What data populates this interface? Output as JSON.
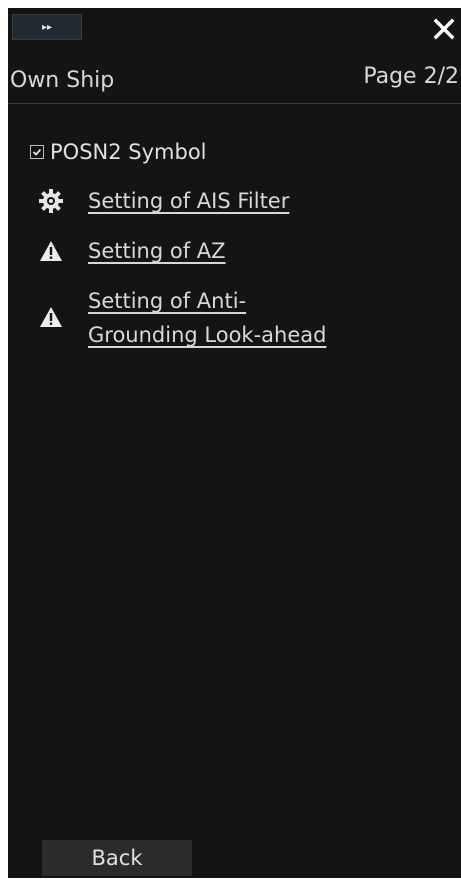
{
  "topbar": {
    "expand_glyph": "▸▸",
    "close_icon": "close-icon"
  },
  "header": {
    "title": "Own Ship",
    "page": "Page 2/2"
  },
  "items": {
    "posn2": {
      "label": "POSN2 Symbol",
      "checked": true
    },
    "ais_filter": {
      "label": "Setting of AIS Filter",
      "icon": "gear-icon"
    },
    "az": {
      "label": "Setting of AZ",
      "icon": "warning-icon"
    },
    "anti_grounding": {
      "label": "Setting of Anti-\nGrounding Look-ahead",
      "icon": "warning-icon"
    }
  },
  "footer": {
    "back_label": "Back"
  },
  "colors": {
    "panel_bg": "#141414",
    "text": "#d8d8d8",
    "button_bg": "#2b2b2b"
  }
}
